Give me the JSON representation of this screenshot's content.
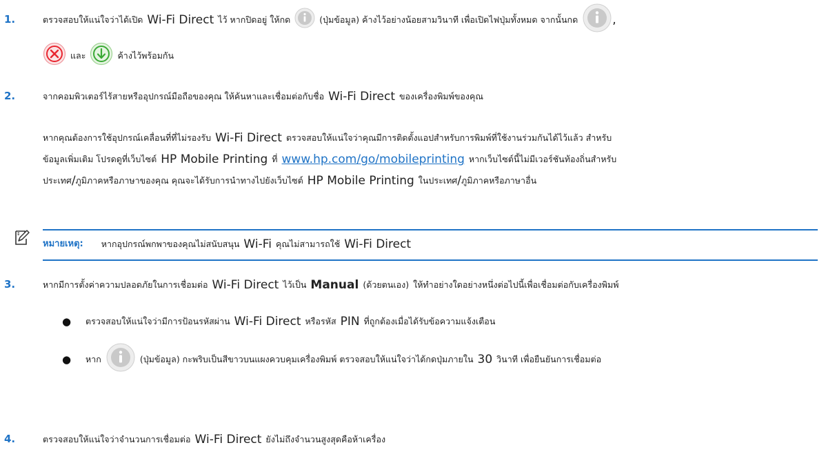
{
  "steps": {
    "s1": {
      "num": "1.",
      "l1_a": "ตรวจสอบให้แน่ใจว่าได้เปิด",
      "l1_wfd": "Wi-Fi Direct",
      "l1_b": "ไว้ หากปิดอยู่ ให้กด",
      "l1_c": "(ปุ่มข้อมูล) ค้างไว้อย่างน้อยสามวินาที เพื่อเปิดไฟปุ่มทั้งหมด จากนั้นกด",
      "l1_comma": ",",
      "l2_and": "และ",
      "l2_end": "ค้างไว้พร้อมกัน"
    },
    "s2": {
      "num": "2.",
      "l1_a": "จากคอมพิวเตอร์ไร้สายหรืออุปกรณ์มือถือของคุณ ให้ค้นหาและเชื่อมต่อกับชื่อ",
      "l1_wfd": "Wi-Fi Direct",
      "l1_b": "ของเครื่องพิมพ์ของคุณ",
      "p1_a": "หากคุณต้องการใช้อุปกรณ์เคลื่อนที่ที่ไม่รองรับ",
      "p1_wfd": "Wi-Fi Direct",
      "p1_b": "ตรวจสอบให้แน่ใจว่าคุณมีการติดตั้งแอปสำหรับการพิมพ์ที่ใช้งานร่วมกันได้ไว้แล้ว สำหรับ",
      "p2_a": "ข้อมูลเพิ่มเติม โปรดดูที่เว็บไซต์",
      "p2_hp": "HP Mobile Printing",
      "p2_b": "ที่",
      "p2_link": "www.hp.com/go/mobileprinting",
      "p2_c": "หากเว็บไซต์นี้ไม่มีเวอร์ชันท้องถิ่นสำหรับ",
      "p3_a": "ประเทศ",
      "p3_slash": "/",
      "p3_b": "ภูมิภาคหรือภาษาของคุณ คุณจะได้รับการนำทางไปยังเว็บไซต์",
      "p3_hp": "HP Mobile Printing",
      "p3_c": "ในประเทศ",
      "p3_slash2": "/",
      "p3_d": "ภูมิภาคหรือภาษาอื่น"
    },
    "note": {
      "label": "หมายเหตุ:",
      "text_a": "หากอุปกรณ์พกพาของคุณไม่สนับสนุน",
      "wifi": "Wi-Fi",
      "text_b": "คุณไม่สามารถใช้",
      "wfd": "Wi-Fi Direct"
    },
    "s3": {
      "num": "3.",
      "l1_a": "หากมีการตั้งค่าความปลอดภัยในการเชื่อมต่อ",
      "l1_wfd": "Wi-Fi Direct",
      "l1_b": "ไว้เป็น",
      "l1_manual": "Manual",
      "l1_c": "(ด้วยตนเอง)",
      "l1_d": "ให้ทำอย่างใดอย่างหนึ่งต่อไปนี้เพื่อเชื่อมต่อกับเครื่องพิมพ์",
      "b1_a": "ตรวจสอบให้แน่ใจว่ามีการป้อนรหัสผ่าน",
      "b1_wfd": "Wi-Fi Direct",
      "b1_b": "หรือรหัส",
      "b1_pin": "PIN",
      "b1_c": "ที่ถูกต้องเมื่อได้รับข้อความแจ้งเตือน",
      "b2_a": "หาก",
      "b2_b": "(ปุ่มข้อมูล) กะพริบเป็นสีขาวบนแผงควบคุมเครื่องพิมพ์ ตรวจสอบให้แน่ใจว่าได้กดปุ่มภายใน",
      "b2_30": "30",
      "b2_c": "วินาที เพื่อยืนยันการเชื่อมต่อ"
    },
    "s4": {
      "num": "4.",
      "l1_a": "ตรวจสอบให้แน่ใจว่าจำนวนการเชื่อมต่อ",
      "l1_wfd": "Wi-Fi Direct",
      "l1_b": "ยังไม่ถึงจำนวนสูงสุดคือห้าเครื่อง"
    }
  },
  "bullet_char": "●",
  "icons": {
    "info": "info-icon",
    "cancel": "cancel-icon",
    "resume": "resume-icon",
    "note": "note-icon"
  },
  "colors": {
    "accent": "#1f73c6",
    "cancel": "#e8252f",
    "resume": "#3aa935",
    "icon_gray": "#c8c8c8"
  }
}
